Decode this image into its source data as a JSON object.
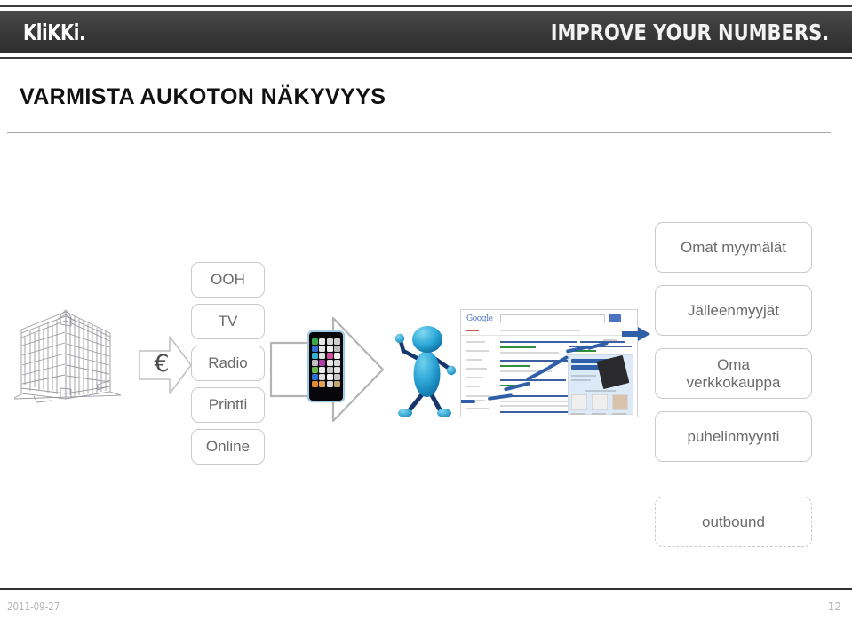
{
  "header": {
    "logo": "KliKKi.",
    "tagline": "IMPROVE YOUR NUMBERS."
  },
  "slide": {
    "title": "VARMISTA AUKOTON NÄKYVYYS"
  },
  "diagram": {
    "building_label": "building-line-art",
    "euro_symbol": "€",
    "channels": [
      {
        "label": "OOH"
      },
      {
        "label": "TV"
      },
      {
        "label": "Radio"
      },
      {
        "label": "Printti"
      },
      {
        "label": "Online"
      }
    ],
    "outlets": [
      {
        "label": "Omat myymälät",
        "style": "solid"
      },
      {
        "label": "Jälleenmyyjät",
        "style": "solid"
      },
      {
        "label": "Oma verkkokauppa",
        "style": "solid"
      },
      {
        "label": "puhelinmyynti",
        "style": "solid"
      },
      {
        "label": "outbound",
        "style": "dashed"
      }
    ],
    "google_logo": "Google",
    "colors": {
      "chip_border": "#c9c9c9",
      "chip_text": "#6a6a6a",
      "arrow_outline": "#b4b4b4",
      "blue_arrow": "#2f5fa8",
      "person_blue": "#29a8d8",
      "person_limb": "#18366b",
      "banner_dark": "#3a3a3a"
    }
  },
  "footer": {
    "date": "2011-09-27",
    "page_number": "12"
  }
}
